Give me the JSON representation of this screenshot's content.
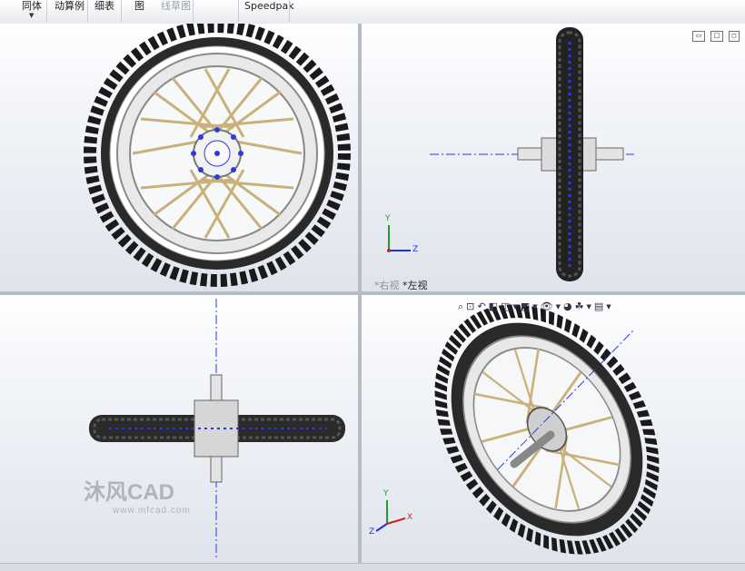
{
  "toolbar": {
    "items": [
      "同体",
      "动算例",
      "细表",
      "图",
      "线草图",
      "Speedpak"
    ]
  },
  "views": {
    "top_right_label_prefix": "*右视",
    "top_right_label": "*左视"
  },
  "watermark": {
    "logo_text": "沐风CAD",
    "url": "www.mfcad.com"
  },
  "axes": {
    "x": "X",
    "y": "Y",
    "z": "Z"
  },
  "colors": {
    "tire": "#1d1d1d",
    "rim": "#c8c8c8",
    "spoke": "#c9b27a",
    "sketch": "#2a3adf",
    "axis_x": "#d21f1f",
    "axis_y": "#1f9e2f",
    "axis_z": "#2030d8"
  }
}
